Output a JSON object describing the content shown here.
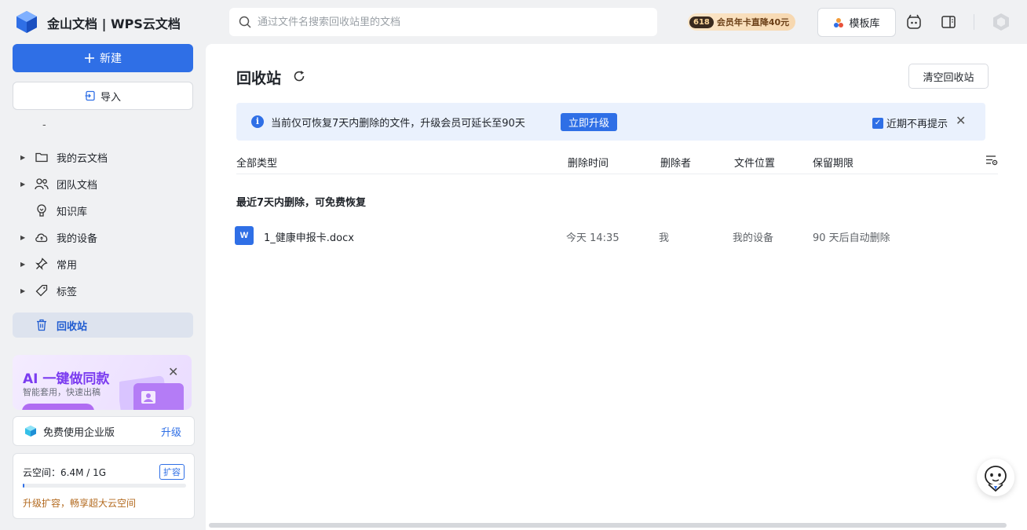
{
  "header": {
    "brand": "金山文档 | WPS云文档",
    "search_placeholder": "通过文件名搜索回收站里的文档",
    "promo_badge": "618",
    "promo_text": "会员年卡直降40元",
    "template_label": "模板库"
  },
  "sidebar": {
    "new_label": "新建",
    "import_label": "导入",
    "items": [
      {
        "label": "我的云文档",
        "icon": "folder-icon",
        "arrow": true
      },
      {
        "label": "团队文档",
        "icon": "team-icon",
        "arrow": true
      },
      {
        "label": "知识库",
        "icon": "bulb-icon",
        "arrow": false
      },
      {
        "label": "我的设备",
        "icon": "cloud-icon",
        "arrow": true
      },
      {
        "label": "常用",
        "icon": "pin-icon",
        "arrow": true
      },
      {
        "label": "标签",
        "icon": "tag-icon",
        "arrow": true
      },
      {
        "label": "回收站",
        "icon": "trash-icon",
        "arrow": false,
        "active": true
      }
    ],
    "ai_card": {
      "title": "AI 一键做同款",
      "subtitle": "智能套用，快速出稿"
    },
    "enterprise": {
      "label": "免费使用企业版",
      "action": "升级"
    },
    "storage": {
      "label": "云空间：6.4M / 1G",
      "expand_label": "扩容",
      "used_fraction": 0.0063,
      "tip": "升级扩容，畅享超大云空间"
    }
  },
  "main": {
    "title": "回收站",
    "clear_label": "清空回收站",
    "notice": {
      "text": "当前仅可恢复7天内删除的文件，升级会员可延长至90天",
      "upgrade_label": "立即升级",
      "dont_remind_label": "近期不再提示"
    },
    "columns": {
      "type": "全部类型",
      "deleted_time": "删除时间",
      "deleter": "删除者",
      "location": "文件位置",
      "retention": "保留期限"
    },
    "group_title": "最近7天内删除，可免费恢复",
    "rows": [
      {
        "name": "1_健康申报卡.docx",
        "deleted_time": "今天 14:35",
        "deleter": "我",
        "location": "我的设备",
        "retention": "90 天后自动删除",
        "icon_letter": "W"
      }
    ]
  },
  "colors": {
    "accent": "#2f6fe6",
    "notice_bg": "#eaf1fd",
    "ai_purple": "#7b3cf0"
  }
}
